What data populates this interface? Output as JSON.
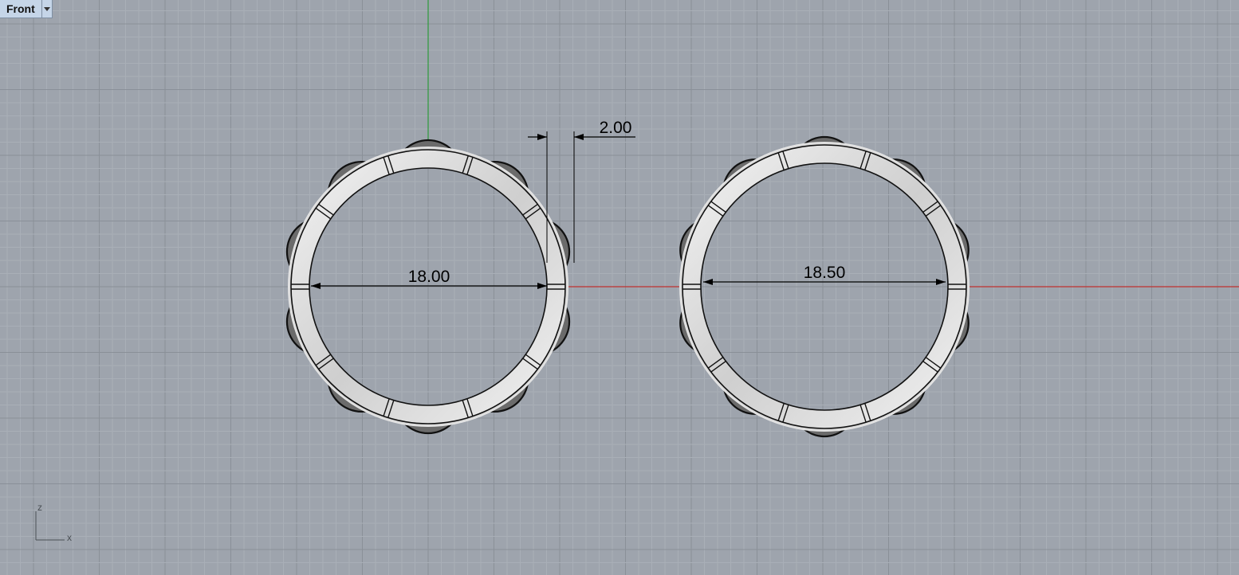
{
  "viewport": {
    "name": "Front",
    "menu_icon": "chevron-down-icon"
  },
  "colors": {
    "background": "#9ea4ad",
    "grid_minor": "#a9afb7",
    "grid_major": "#8a9098",
    "x_axis": "#c03030",
    "z_axis": "#2e9b3a"
  },
  "dimensions": {
    "left_ring_inner": "18.00",
    "thickness": "2.00",
    "right_ring_inner": "18.50"
  },
  "axes_widget": {
    "vertical": "z",
    "horizontal": "x"
  }
}
